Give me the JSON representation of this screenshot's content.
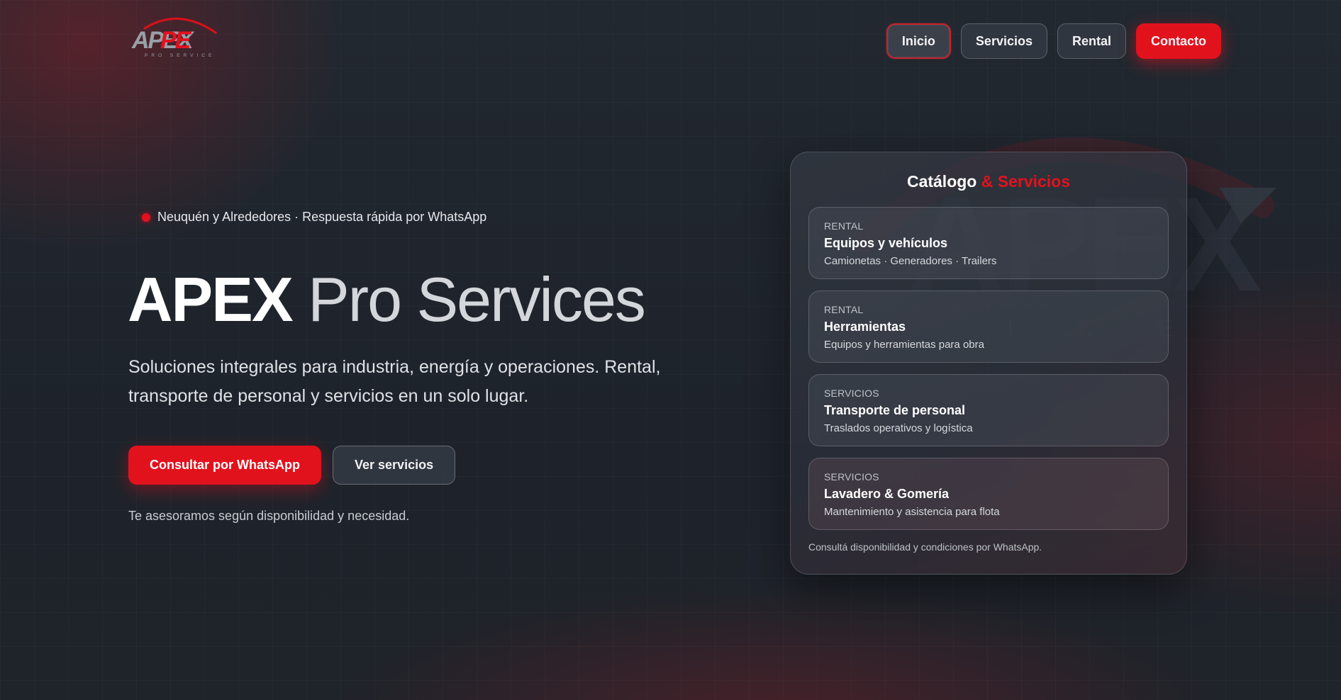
{
  "brand": {
    "logo_main": "APEX",
    "logo_sub": "PRO SERVICE"
  },
  "nav": {
    "items": [
      {
        "label": "Inicio",
        "active": true
      },
      {
        "label": "Servicios",
        "active": false
      },
      {
        "label": "Rental",
        "active": false
      },
      {
        "label": "Contacto",
        "cta": true
      }
    ]
  },
  "hero": {
    "tagline": "Neuquén y Alrededores · Respuesta rápida por WhatsApp",
    "title_part1": "APEX",
    "title_part2": "Pro Services",
    "description": "Soluciones integrales para industria, energía y operaciones. Rental, transporte de personal y servicios en un solo lugar.",
    "primary_button": "Consultar por WhatsApp",
    "secondary_button": "Ver servicios",
    "note": "Te asesoramos según disponibilidad y necesidad."
  },
  "catalog": {
    "title_part1": "Catálogo",
    "title_part2": "& Servicios",
    "items": [
      {
        "kicker": "RENTAL",
        "name": "Equipos y vehículos",
        "desc": "Camionetas · Generadores · Trailers"
      },
      {
        "kicker": "RENTAL",
        "name": "Herramientas",
        "desc": "Equipos y herramientas para obra"
      },
      {
        "kicker": "SERVICIOS",
        "name": "Transporte de personal",
        "desc": "Traslados operativos y logística"
      },
      {
        "kicker": "SERVICIOS",
        "name": "Lavadero & Gomería",
        "desc": "Mantenimiento y asistencia para flota"
      }
    ],
    "footer": "Consultá disponibilidad y condiciones por WhatsApp."
  },
  "colors": {
    "accent": "#e2121d",
    "background": "#1e232b"
  }
}
